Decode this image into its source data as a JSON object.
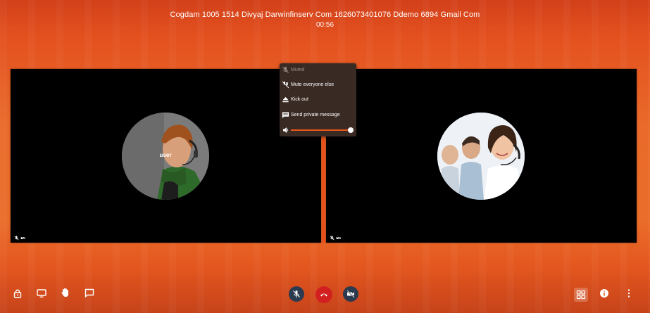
{
  "call": {
    "title": "Cogdam 1005 1514 Divyaj Darwinfinserv Com 1626073401076 Ddemo 6894 Gmail Com",
    "timer": "00:56"
  },
  "participants": [
    {
      "avatar_label": "user",
      "audio_muted": true
    },
    {
      "avatar_label": "",
      "audio_muted": true
    }
  ],
  "menu": {
    "items": [
      {
        "label": "Muted",
        "icon": "mic-off-icon",
        "disabled": true
      },
      {
        "label": "Mute everyone else",
        "icon": "mute-everyone-icon",
        "disabled": false
      },
      {
        "label": "Kick out",
        "icon": "eject-icon",
        "disabled": false
      },
      {
        "label": "Send private message",
        "icon": "message-icon",
        "disabled": false
      }
    ],
    "volume": 0.97
  },
  "toolbar": {
    "left": [
      "lock-icon",
      "screen-share-icon",
      "raise-hand-icon",
      "chat-icon"
    ],
    "center": [
      "mic-off-icon",
      "hangup-icon",
      "video-off-icon"
    ],
    "right": [
      "tile-view-icon",
      "info-icon",
      "more-icon"
    ]
  },
  "colors": {
    "accent": "#e8581a",
    "hangup": "#d21f1f",
    "center_button": "#2c3a4f",
    "menu_bg": "#3a2a24"
  }
}
